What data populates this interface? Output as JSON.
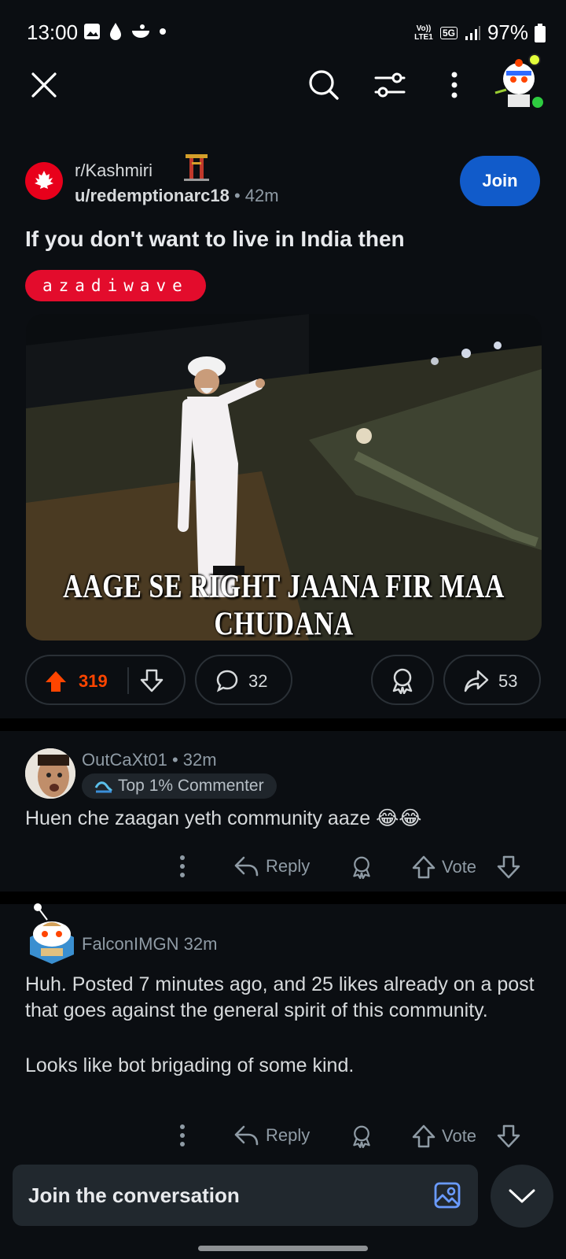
{
  "status": {
    "time": "13:00",
    "network": "Vo)) LTE1",
    "network_type": "5G",
    "battery": "97%"
  },
  "post": {
    "subreddit": "r/Kashmiri",
    "author": "u/redemptionarc18",
    "age": "42m",
    "join_label": "Join",
    "title": "If you don't want to live in India then",
    "flair": "azadiwave",
    "image_caption": "AAGE SE RIGHT JAANA FIR MAA CHUDANA",
    "upvotes": "319",
    "comments": "32",
    "shares": "53"
  },
  "comments": [
    {
      "user": "OutCaXt01",
      "age": "32m",
      "badge": "Top 1% Commenter",
      "body": "Huen che zaagan yeth community aaze 😂😂",
      "reply_label": "Reply",
      "vote_label": "Vote"
    },
    {
      "user": "FalconIMGN",
      "age": "32m",
      "body_p1": "Huh. Posted 7 minutes ago, and 25 likes already on a post that goes against the general spirit of this community.",
      "body_p2": "Looks like bot brigading of some kind.",
      "reply_label": "Reply",
      "vote_label": "Vote"
    }
  ],
  "compose": {
    "placeholder": "Join the conversation"
  },
  "colors": {
    "accent": "#ff4500",
    "join": "#115bca",
    "flair": "#e30c2c"
  }
}
